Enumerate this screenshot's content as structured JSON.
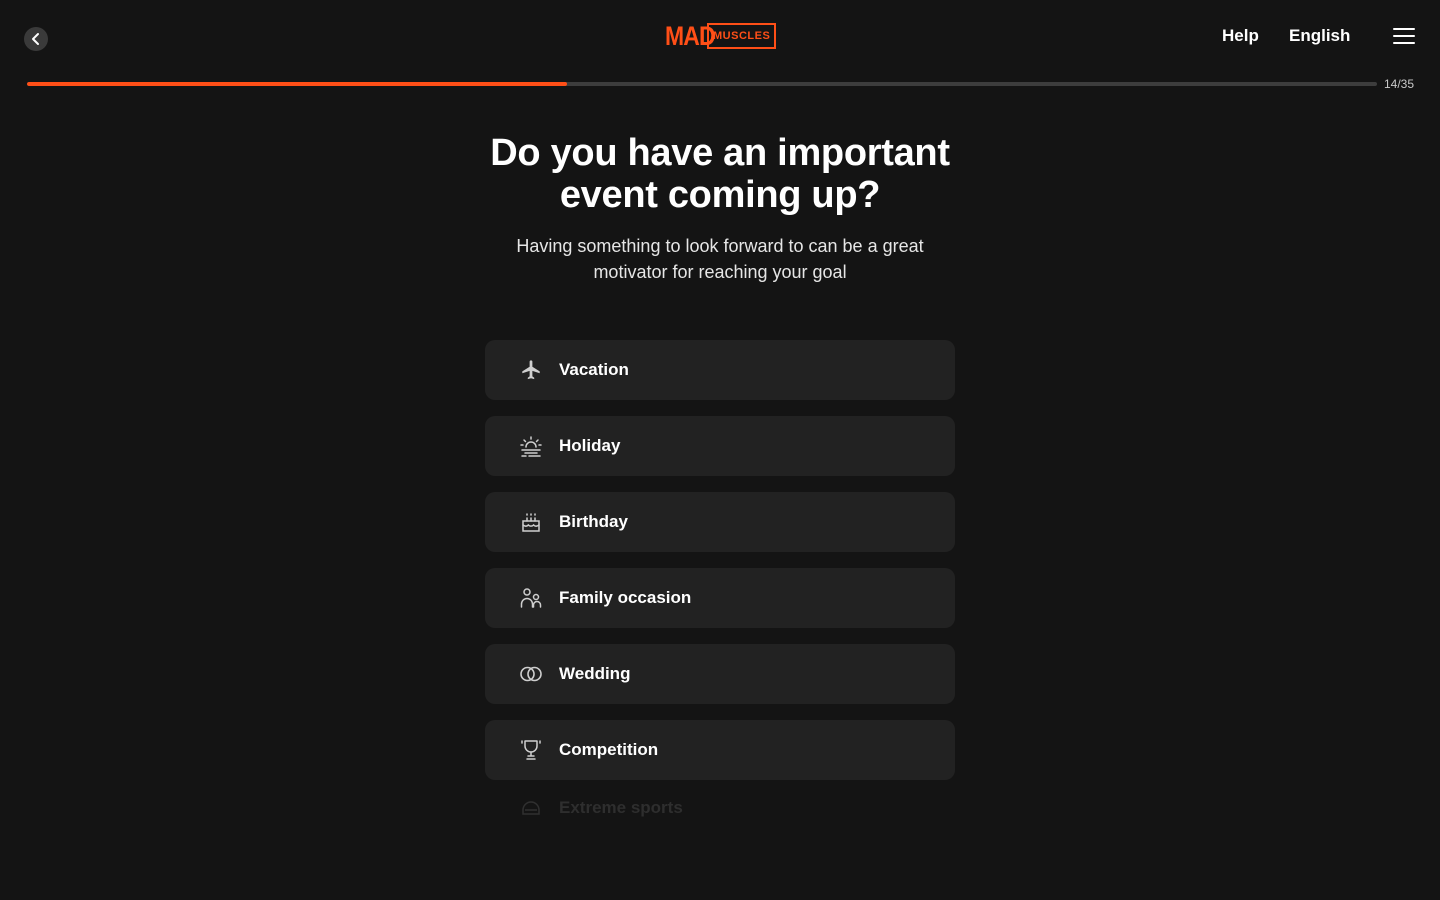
{
  "header": {
    "logo_mad": "MAD",
    "logo_muscles": "MUSCLES",
    "help_label": "Help",
    "language_label": "English"
  },
  "progress": {
    "current": 14,
    "total": 35,
    "text": "14/35",
    "fraction": 0.4
  },
  "question": {
    "title": "Do you have an important event coming up?",
    "subtitle": "Having something to look forward to can be a great motivator for reaching your goal"
  },
  "options": [
    {
      "label": "Vacation",
      "icon": "airplane-icon"
    },
    {
      "label": "Holiday",
      "icon": "sunrise-icon"
    },
    {
      "label": "Birthday",
      "icon": "cake-icon"
    },
    {
      "label": "Family occasion",
      "icon": "people-icon"
    },
    {
      "label": "Wedding",
      "icon": "rings-icon"
    },
    {
      "label": "Competition",
      "icon": "trophy-icon"
    },
    {
      "label": "Extreme sports",
      "icon": "helmet-icon"
    }
  ],
  "colors": {
    "accent": "#ff4f17",
    "background": "#141414",
    "card": "#222222"
  }
}
